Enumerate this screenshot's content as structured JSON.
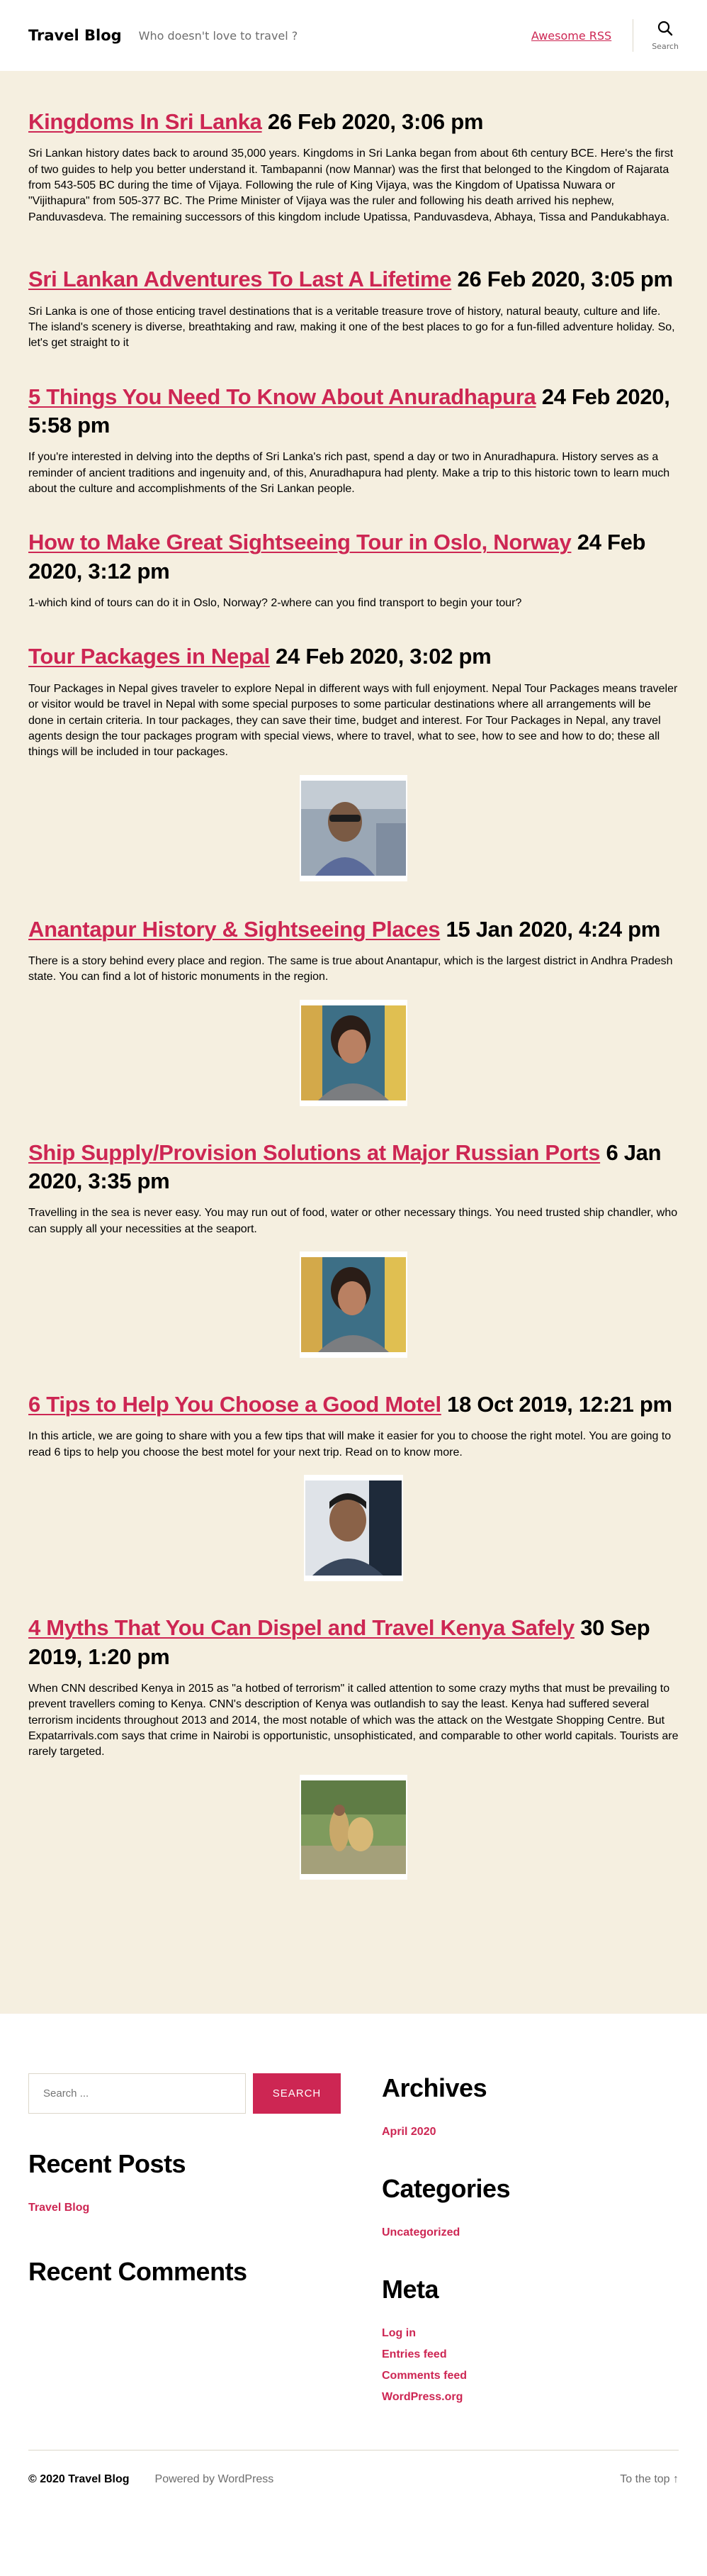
{
  "header": {
    "site_title": "Travel Blog",
    "tagline": "Who doesn't love to travel ?",
    "menu_link": "Awesome RSS",
    "search_label": "Search"
  },
  "posts": [
    {
      "title": "Kingdoms In Sri Lanka",
      "date": "26 Feb 2020, 3:06 pm",
      "excerpt": "Sri Lankan history dates back to around 35,000 years. Kingdoms in Sri Lanka began from about 6th century BCE. Here's the first of two guides to help you better understand it. Tambapanni (now Mannar) was the first that belonged to the Kingdom of Rajarata from 543-505 BC during the time of Vijaya. Following the rule of King Vijaya, was the Kingdom of Upatissa Nuwara or \"Vijithapura\" from 505-377 BC. The Prime Minister of Vijaya was the ruler and following his death arrived his nephew, Panduvasdeva. The remaining successors of this kingdom include Upatissa, Panduvasdeva, Abhaya, Tissa and Pandukabhaya."
    },
    {
      "title": "Sri Lankan Adventures To Last A Lifetime",
      "date": "26 Feb 2020, 3:05 pm",
      "excerpt": "Sri Lanka is one of those enticing travel destinations that is a veritable treasure trove of history, natural beauty, culture and life. The island's scenery is diverse, breathtaking and raw, making it one of the best places to go for a fun-filled adventure holiday. So, let's get straight to it"
    },
    {
      "title": "5 Things You Need To Know About Anuradhapura",
      "date": "24 Feb 2020, 5:58 pm",
      "excerpt": "If you're interested in delving into the depths of Sri Lanka's rich past, spend a day or two in Anuradhapura. History serves as a reminder of ancient traditions and ingenuity and, of this, Anuradhapura had plenty. Make a trip to this historic town to learn much about the culture and accomplishments of the Sri Lankan people."
    },
    {
      "title": "How to Make Great Sightseeing Tour in Oslo, Norway",
      "date": "24 Feb 2020, 3:12 pm",
      "excerpt": "1-which kind of tours can do it in Oslo, Norway? 2-where can you find transport to begin your tour?"
    },
    {
      "title": "Tour Packages in Nepal",
      "date": "24 Feb 2020, 3:02 pm",
      "excerpt": "Tour Packages in Nepal gives traveler to explore Nepal in different ways with full enjoyment. Nepal Tour Packages means traveler or visitor would be travel in Nepal with some special purposes to some particular destinations where all arrangements will be done in certain criteria. In tour packages, they can save their time, budget and interest. For Tour Packages in Nepal, any travel agents design the tour packages program with special views, where to travel, what to see, how to see and how to do; these all things will be included in tour packages.",
      "image": "man-portrait-sunglasses"
    },
    {
      "title": "Anantapur History & Sightseeing Places",
      "date": "15 Jan 2020, 4:24 pm",
      "excerpt": "There is a story behind every place and region. The same is true about Anantapur, which is the largest district in Andhra Pradesh state. You can find a lot of historic monuments in the region.",
      "image": "woman-portrait"
    },
    {
      "title": "Ship Supply/Provision Solutions at Major Russian Ports",
      "date": "6 Jan 2020, 3:35 pm",
      "excerpt": "Travelling in the sea is never easy. You may run out of food, water or other necessary things. You need trusted ship chandler, who can supply all your necessities at the seaport.",
      "image": "woman-portrait"
    },
    {
      "title": "6 Tips to Help You Choose a Good Motel",
      "date": "18 Oct 2019, 12:21 pm",
      "excerpt": "In this article, we are going to share with you a few tips that will make it easier for you to choose the right motel. You are going to read 6 tips to help you choose the best motel for your next trip. Read on to know more.",
      "image": "man-portrait-headphones"
    },
    {
      "title": "4 Myths That You Can Dispel and Travel Kenya Safely",
      "date": "30 Sep 2019, 1:20 pm",
      "excerpt": "When CNN described Kenya in 2015 as \"a hotbed of terrorism\" it called attention to some crazy myths that must be prevailing to prevent travellers coming to Kenya. CNN's description of Kenya was outlandish to say the least. Kenya had suffered several terrorism incidents throughout 2013 and 2014, the most notable of which was the attack on the Westgate Shopping Centre. But Expatarrivals.com says that crime in Nairobi is opportunistic, unsophisticated, and comparable to other world capitals. Tourists are rarely targeted.",
      "image": "cheetah-photo"
    }
  ],
  "widgets": {
    "search_placeholder": "Search ...",
    "search_button": "Search",
    "recent_posts_title": "Recent Posts",
    "recent_posts": [
      "Travel Blog"
    ],
    "recent_comments_title": "Recent Comments",
    "archives_title": "Archives",
    "archives": [
      "April 2020"
    ],
    "categories_title": "Categories",
    "categories": [
      "Uncategorized"
    ],
    "meta_title": "Meta",
    "meta": [
      "Log in",
      "Entries feed",
      "Comments feed",
      "WordPress.org"
    ]
  },
  "footer": {
    "copyright": "© 2020 Travel Blog",
    "powered": "Powered by WordPress",
    "to_top": "To the top ↑"
  },
  "colors": {
    "accent": "#cd2653",
    "content_background": "#f5efe0",
    "secondary_text": "#6d6d6d"
  }
}
